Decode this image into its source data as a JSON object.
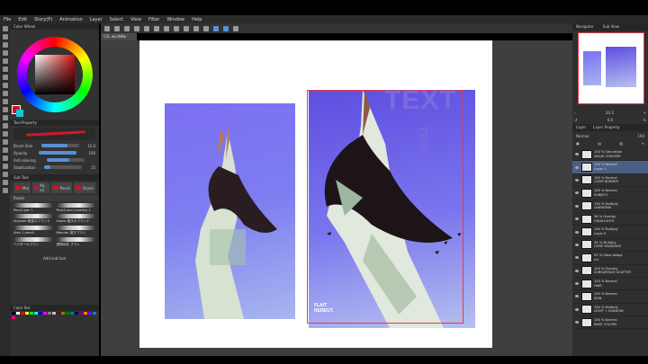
{
  "menu": [
    "File",
    "Edit",
    "Story(P)",
    "Animation",
    "Layer",
    "Select",
    "View",
    "Filter",
    "Window",
    "Help"
  ],
  "document_tab": "CSL wcaNNe",
  "color_wheel": {
    "title": "Color Wheel",
    "main_color": "#d3102a",
    "sub_color": "#16c6d9"
  },
  "tool_property": {
    "title": "Tool Property",
    "rows": [
      {
        "label": "Brush Size",
        "value": "12.0"
      },
      {
        "label": "Opacity",
        "value": "100"
      },
      {
        "label": "Anti-aliasing",
        "value": ""
      },
      {
        "label": "Stabilization",
        "value": "15"
      }
    ]
  },
  "sub_tool": {
    "title": "Sub Tool",
    "tabs": [
      "Mai",
      "My ori",
      "Pencil",
      "Bryon"
    ],
    "group": "Pastel",
    "brushes": [
      "Pencil pen 1",
      "Pencil pen (middle) 1",
      "Impasto 長塗のブラシナ",
      "Impas 描きのブラシナ",
      "Alen 1 pencil",
      "Blender 描きブラシ",
      "ベクターのブラシ",
      "透明水彩 ブラシ"
    ],
    "add_label": "Add sub tool"
  },
  "palette_title": "Color Set",
  "palette": [
    "#000000",
    "#ffffff",
    "#ff0000",
    "#ffff00",
    "#00ff00",
    "#00ffff",
    "#0000ff",
    "#ff00ff",
    "#808080",
    "#c0c0c0",
    "#800000",
    "#808000",
    "#008000",
    "#008080",
    "#000080",
    "#800080",
    "#ff8000",
    "#8000ff",
    "#0080ff",
    "#ff0080"
  ],
  "canvas": {
    "headline": "TEXT",
    "subhead": "TEXT",
    "signature_line1": "FLAIT",
    "signature_line2": "REREGT."
  },
  "navigator": {
    "tab1": "Navigator",
    "tab2": "Sub View",
    "zoom": "24.3",
    "angle": "0.0"
  },
  "layer_panel": {
    "tabs": [
      "Layer",
      "Layer Property"
    ],
    "blend_mode": "Normal",
    "opacity": "100",
    "layers": [
      {
        "line1": "100 % Saturation",
        "line2": "VALUE CHECKER",
        "selected": false
      },
      {
        "line1": "100 % Normal",
        "line2": "Layer 1",
        "selected": true
      },
      {
        "line1": "100 % Normal",
        "line2": "COMP BORDER",
        "selected": false
      },
      {
        "line1": "100 % Normal",
        "line2": "SUBJECT",
        "selected": false
      },
      {
        "line1": "100 % Multiply",
        "line2": "LINEWORK",
        "selected": false
      },
      {
        "line1": "56 % Overlay",
        "line2": "HIGHLIGHTS",
        "selected": false
      },
      {
        "line1": "100 % Multiply",
        "line2": "Layer 9",
        "selected": false
      },
      {
        "line1": "34 % Multiply",
        "line2": "CORE SHADOWS",
        "selected": false
      },
      {
        "line1": "92 % Glow dodge",
        "line2": "rm",
        "selected": false
      },
      {
        "line1": "100 % Overlay",
        "line2": "SUBSURFACE SCATTER",
        "selected": false
      },
      {
        "line1": "100 % Normal",
        "line2": "HAIR",
        "selected": false
      },
      {
        "line1": "100 % Normal",
        "line2": "SKIN",
        "selected": false
      },
      {
        "line1": "100 % Multiply",
        "line2": "LIGHT + SHADOW",
        "selected": false
      },
      {
        "line1": "100 % Normal",
        "line2": "BASE COLORS",
        "selected": false
      }
    ]
  }
}
